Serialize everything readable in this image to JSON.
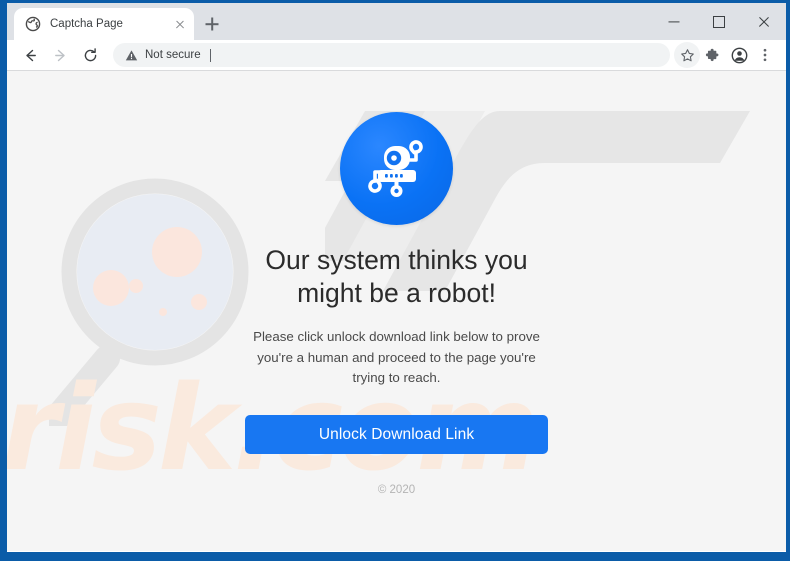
{
  "browser": {
    "tab": {
      "title": "Captcha Page",
      "favicon_icon": "globe-icon",
      "close_icon": "close-icon"
    },
    "new_tab_icon": "plus-icon",
    "window_controls": {
      "minimize_icon": "minimize-icon",
      "maximize_icon": "maximize-icon",
      "close_icon": "close-icon"
    },
    "toolbar": {
      "back_icon": "arrow-left-icon",
      "forward_icon": "arrow-right-icon",
      "reload_icon": "reload-icon",
      "security_label": "Not secure",
      "security_icon": "warning-triangle-icon",
      "address_value": "",
      "address_placeholder": "",
      "bookmark_icon": "star-icon",
      "extensions_icon": "puzzle-piece-icon",
      "profile_icon": "account-circle-icon",
      "menu_icon": "three-dot-menu-icon"
    },
    "border_color": "#0b5ca8",
    "tabstrip_color": "#dee1e6"
  },
  "page": {
    "robot_icon": "robot-icon",
    "headline": "Our system thinks you might be a robot!",
    "subtext": "Please click unlock download link below to prove you're a human and proceed to the page you're trying to reach.",
    "unlock_button_label": "Unlock Download Link",
    "copyright": "© 2020",
    "background_color": "#f5f5f5",
    "accent_color": "#1877f2",
    "watermark_text": "risk.com",
    "watermark_color": "#faeade",
    "watermark_logo": "pc-logo-watermark",
    "watermark_magnifier": "magnifying-glass-watermark"
  }
}
